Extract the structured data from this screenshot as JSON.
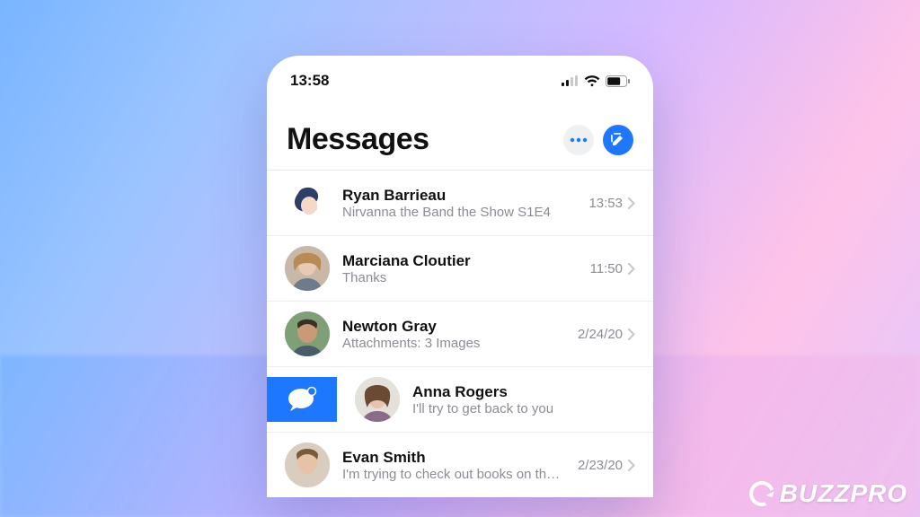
{
  "status": {
    "time": "13:58"
  },
  "header": {
    "title": "Messages"
  },
  "colors": {
    "accent": "#1e78ff"
  },
  "icons": {
    "signal": "signal-icon",
    "wifi": "wifi-icon",
    "battery": "battery-icon",
    "more": "more-icon",
    "compose": "compose-icon",
    "chevron": "chevron-right-icon",
    "chat_bubble": "chat-bubble-icon"
  },
  "threads": [
    {
      "name": "Ryan Barrieau",
      "preview": "Nirvanna the Band the Show S1E4",
      "time": "13:53",
      "avatar_kind": "illustration",
      "swiped": false
    },
    {
      "name": "Marciana Cloutier",
      "preview": "Thanks",
      "time": "11:50",
      "avatar_kind": "photo",
      "swiped": false
    },
    {
      "name": "Newton Gray",
      "preview": "Attachments: 3 Images",
      "time": "2/24/20",
      "avatar_kind": "photo",
      "swiped": false
    },
    {
      "name": "Anna Rogers",
      "preview": "I'll try to get back to you",
      "time": "",
      "avatar_kind": "photo",
      "swiped": true
    },
    {
      "name": "Evan Smith",
      "preview": "I'm trying to check out books on the library",
      "time": "2/23/20",
      "avatar_kind": "photo",
      "swiped": false
    }
  ],
  "watermark": {
    "text": "BUZZPRO"
  }
}
